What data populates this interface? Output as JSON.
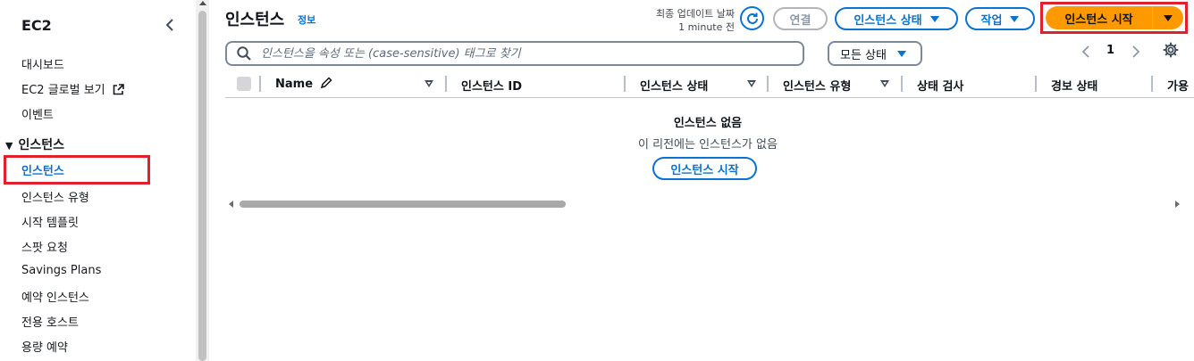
{
  "sidebar": {
    "title": "EC2",
    "links": [
      {
        "label": "대시보드"
      },
      {
        "label": "EC2 글로벌 보기"
      },
      {
        "label": "이벤트"
      }
    ],
    "section": {
      "label": "인스턴스",
      "items": [
        {
          "label": "인스턴스",
          "active": true
        },
        {
          "label": "인스턴스 유형"
        },
        {
          "label": "시작 템플릿"
        },
        {
          "label": "스팟 요청"
        },
        {
          "label": "Savings Plans"
        },
        {
          "label": "예약 인스턴스"
        },
        {
          "label": "전용 호스트"
        },
        {
          "label": "용량 예약"
        }
      ]
    }
  },
  "header": {
    "title": "인스턴스",
    "info": "정보",
    "last_updated_label": "최종 업데이트 날짜",
    "last_updated_value": "1 minute 전",
    "connect_label": "연결",
    "instance_state_label": "인스턴스 상태",
    "actions_label": "작업",
    "launch_label": "인스턴스 시작"
  },
  "filter": {
    "search_placeholder": "인스턴스을 속성 또는 (case-sensitive) 태그로 찾기",
    "state_select": "모든 상태",
    "page": "1"
  },
  "table": {
    "columns": [
      {
        "label": "Name"
      },
      {
        "label": "인스턴스 ID"
      },
      {
        "label": "인스턴스 상태"
      },
      {
        "label": "인스턴스 유형"
      },
      {
        "label": "상태 검사"
      },
      {
        "label": "경보 상태"
      },
      {
        "label": "가용"
      }
    ]
  },
  "empty": {
    "title": "인스턴스 없음",
    "description": "이 리전에는 인스턴스가 없음",
    "button": "인스턴스 시작"
  },
  "colors": {
    "accent": "#0972d3",
    "primary_button": "#ff9900",
    "highlight": "#e0212c"
  }
}
